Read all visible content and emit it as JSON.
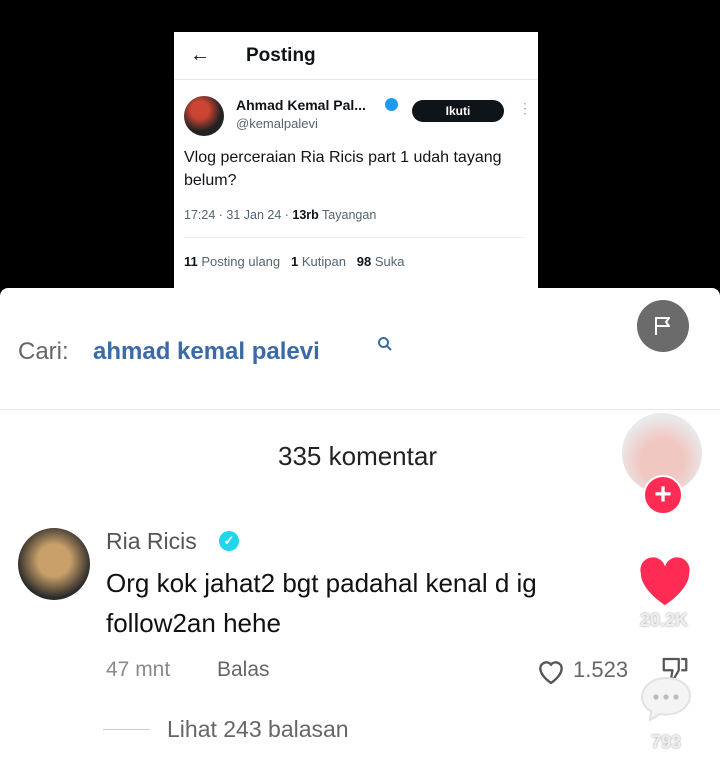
{
  "tweet": {
    "header_title": "Posting",
    "author_name": "Ahmad Kemal Pal...",
    "author_handle": "@kemalpalevi",
    "follow_label": "Ikuti",
    "text": "Vlog perceraian Ria Ricis part 1 udah tayang belum?",
    "time": "17:24 · 31 Jan 24 · ",
    "views_count": "13rb",
    "views_label": " Tayangan",
    "reposts_count": "11",
    "reposts_label": " Posting ulang",
    "quotes_count": "1",
    "quotes_label": " Kutipan",
    "likes_count": "98",
    "likes_label": " Suka"
  },
  "search": {
    "label": "Cari:",
    "query": "ahmad kemal palevi"
  },
  "comments_header": "335 komentar",
  "comment": {
    "user": "Ria Ricis",
    "text": "Org kok jahat2 bgt padahal kenal d ig follow2an hehe",
    "time": "47 mnt",
    "reply_label": "Balas",
    "like_count": "1.523",
    "view_replies": "Lihat 243 balasan"
  },
  "sidebar": {
    "like_count": "20.2K",
    "comment_count": "793"
  },
  "colors": {
    "accent_pink": "#fe2c55",
    "search_blue": "#3b6aa8",
    "verified_twitter": "#1d9bf0",
    "verified_tiktok": "#20d5ec"
  }
}
